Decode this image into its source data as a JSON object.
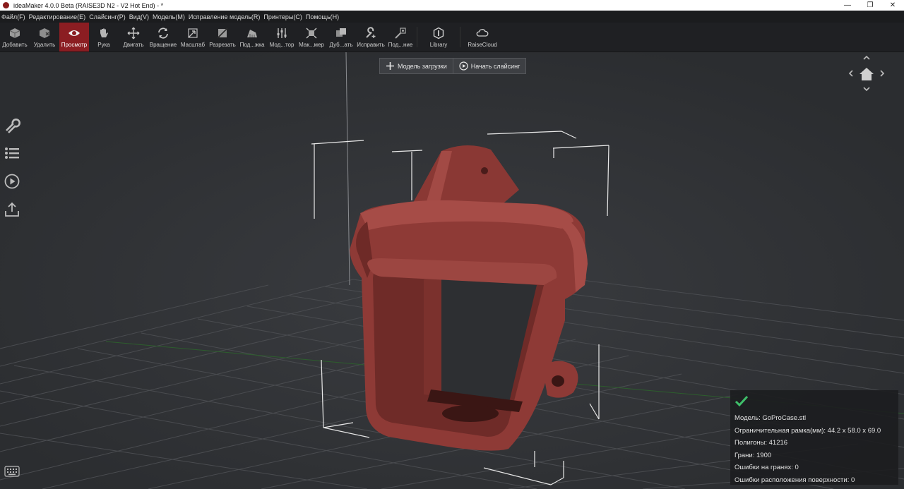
{
  "window": {
    "title": "ideaMaker 4.0.0 Beta (RAISE3D N2 - V2 Hot End) - *",
    "controls": [
      "—",
      "❐",
      "✕"
    ]
  },
  "menu": [
    {
      "label": "Файл(F)"
    },
    {
      "label": "Редактирование(E)"
    },
    {
      "label": "Слайсинг(P)"
    },
    {
      "label": "Вид(V)"
    },
    {
      "label": "Модель(M)"
    },
    {
      "label": "Исправление модель(R)"
    },
    {
      "label": "Принтеры(C)"
    },
    {
      "label": "Помощь(H)"
    }
  ],
  "toolbar": {
    "add": "Добавить",
    "remove": "Удалить",
    "view": "Просмотр",
    "hand": "Рука",
    "move": "Двигать",
    "rotate": "Вращение",
    "scale": "Масштаб",
    "cut": "Разрезать",
    "support": "Под...жка",
    "modifier": "Мод...тор",
    "layout": "Мак...мер",
    "duplicate": "Дуб...ать",
    "repair": "Исправить",
    "sub": "Под...ние",
    "library": "Library",
    "raisecloud": "RaiseCloud"
  },
  "actions": {
    "load_model": "Модель загрузки",
    "start_slicing": "Начать слайсинг"
  },
  "info": {
    "model": "Модель: GoProCase.stl",
    "bbox": "Ограничительная рамка(мм): 44.2 x 58.0 x 69.0",
    "polygons": "Полигоны: 41216",
    "faces": "Грани: 1900",
    "face_errors": "Ошибки на гранях: 0",
    "surface_errors": "Ошибки расположения поверхности: 0"
  },
  "colors": {
    "accent": "#8b1d22",
    "model": "#8e3a36",
    "ok": "#3fbf6a"
  }
}
